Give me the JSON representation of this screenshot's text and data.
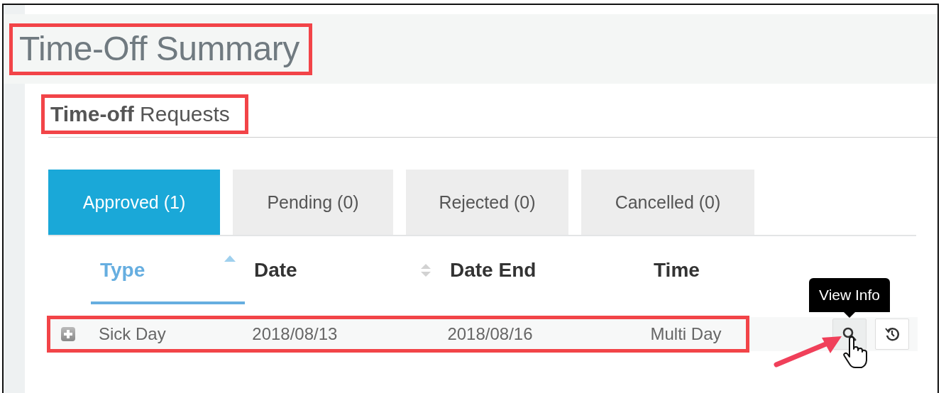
{
  "page_title": {
    "text": "Time-Off Summary",
    "highlighted": true
  },
  "section_title": {
    "text": "**Time-off** Requests",
    "highlighted": true
  },
  "tabs": [
    {
      "label": "Approved (1)",
      "selected": true
    },
    {
      "label": "Pending (0)",
      "selected": false
    },
    {
      "label": "Rejected (0)",
      "selected": false
    },
    {
      "label": "Cancelled (0)",
      "selected": false
    }
  ],
  "table": {
    "columns": [
      {
        "label": "Type",
        "sorted": true,
        "selected": true
      },
      {
        "label": "Date",
        "sorted": false,
        "selected": false
      },
      {
        "label": "Date End",
        "selected": false
      },
      {
        "label": "Time",
        "selected": false
      }
    ],
    "rows": [
      {
        "cells": [
          "Sick Day",
          "2018/08/13",
          "2018/08/16",
          "Multi Day"
        ],
        "highlighted": true,
        "actions": [
          {
            "kind": "view",
            "tooltip": "View Info",
            "hovered": true
          },
          {
            "kind": "history",
            "hovered": false
          }
        ]
      }
    ]
  }
}
